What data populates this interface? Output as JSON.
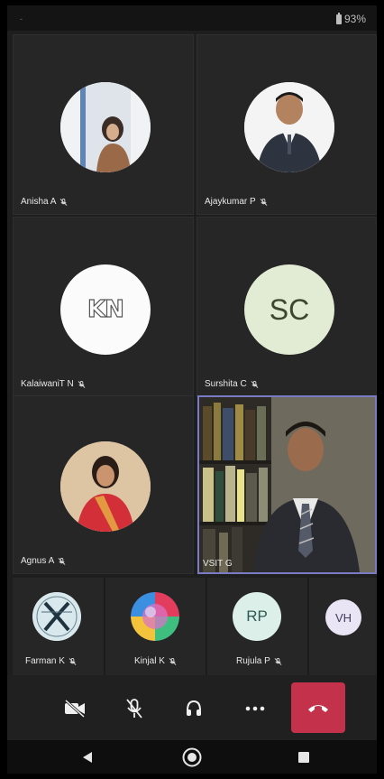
{
  "status_bar": {
    "battery_percent": "93%"
  },
  "grid": [
    {
      "name": "Anisha A",
      "avatar": "photo-woman-cap"
    },
    {
      "name": "Ajaykumar P",
      "avatar": "photo-man-suit"
    },
    {
      "name": "KalaiwaniT N",
      "avatar": "logo-kn",
      "logo_text": "KN"
    },
    {
      "name": "Surshita C",
      "avatar": "initials",
      "initials": "SC"
    },
    {
      "name": "Agnus A",
      "avatar": "photo-woman-saree"
    },
    {
      "name": "VSIT G",
      "avatar": "video-feed",
      "active": true
    }
  ],
  "strip": [
    {
      "name": "Farman K",
      "avatar": "logo-x"
    },
    {
      "name": "Kinjal K",
      "avatar": "colorful-circle"
    },
    {
      "name": "Rujula P",
      "avatar": "initials",
      "initials": "RP"
    },
    {
      "name": "",
      "avatar": "initials",
      "initials": "VH"
    }
  ],
  "controls": {
    "items": [
      "camera-off",
      "mic-off",
      "audio-headset",
      "more-options",
      "hang-up"
    ],
    "hangup_color": "#c4314b"
  },
  "nav": [
    "back",
    "home",
    "recents"
  ],
  "colors": {
    "background": "#1e1e1e",
    "tile": "#262626",
    "active_border": "#7b7ac4"
  }
}
